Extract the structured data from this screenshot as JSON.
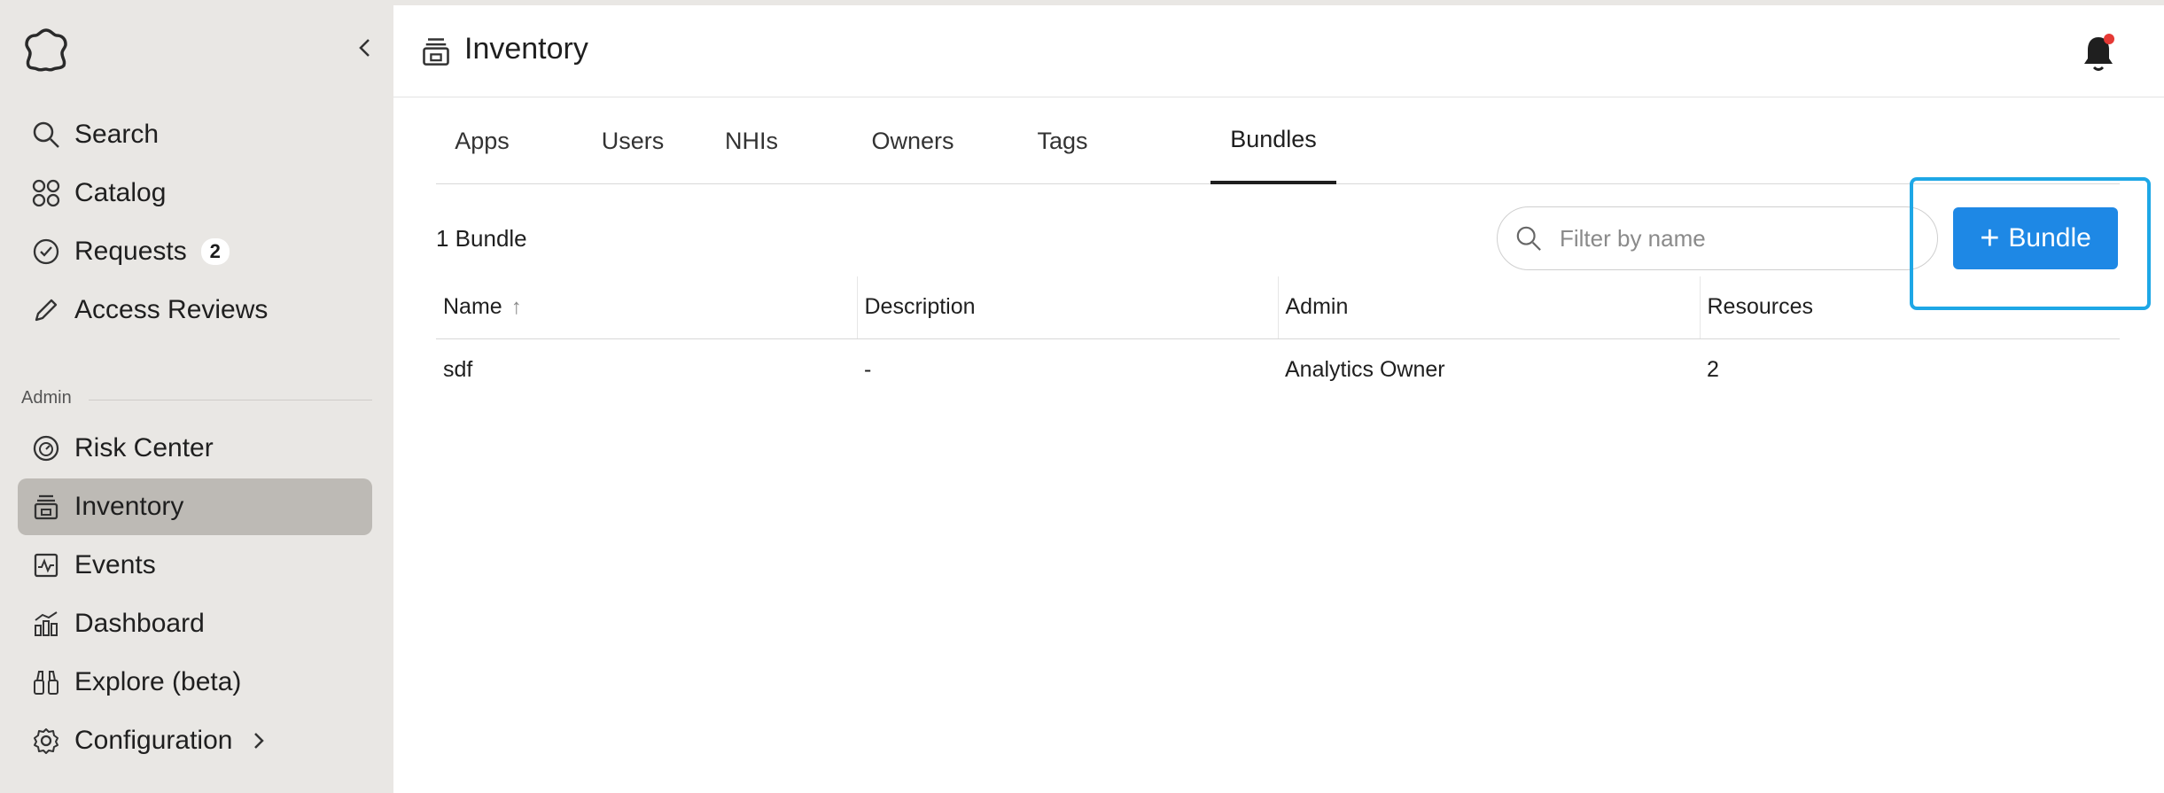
{
  "sidebar": {
    "logo": "org-logo",
    "collapse_icon": "chevron-left-icon",
    "items": [
      {
        "label": "Search",
        "icon": "search-icon"
      },
      {
        "label": "Catalog",
        "icon": "grid-icon"
      },
      {
        "label": "Requests",
        "icon": "check-circle-icon",
        "badge": "2"
      },
      {
        "label": "Access Reviews",
        "icon": "pencil-icon"
      }
    ],
    "admin_section_label": "Admin",
    "admin_items": [
      {
        "label": "Risk Center",
        "icon": "gauge-icon"
      },
      {
        "label": "Inventory",
        "icon": "inventory-icon",
        "active": true
      },
      {
        "label": "Events",
        "icon": "activity-icon"
      },
      {
        "label": "Dashboard",
        "icon": "bar-chart-icon"
      },
      {
        "label": "Explore (beta)",
        "icon": "binoculars-icon"
      },
      {
        "label": "Configuration",
        "icon": "gear-icon"
      }
    ]
  },
  "header": {
    "title": "Inventory",
    "icon": "inventory-icon",
    "notification_icon": "bell-icon",
    "notification_dot_color": "#e53935"
  },
  "tabs": [
    "Apps",
    "Users",
    "NHIs",
    "Owners",
    "Tags",
    "Bundles"
  ],
  "active_tab": "Bundles",
  "toolbar": {
    "count_label": "1 Bundle",
    "filter_placeholder": "Filter by name",
    "add_button_label": "Bundle",
    "accent_color": "#1e88e5",
    "highlight_color": "#1ea7e6"
  },
  "table": {
    "columns": [
      "Name",
      "Description",
      "Admin",
      "Resources"
    ],
    "sort_column": "Name",
    "rows": [
      {
        "name": "sdf",
        "description": "-",
        "admin": "Analytics Owner",
        "resources": "2"
      }
    ]
  }
}
